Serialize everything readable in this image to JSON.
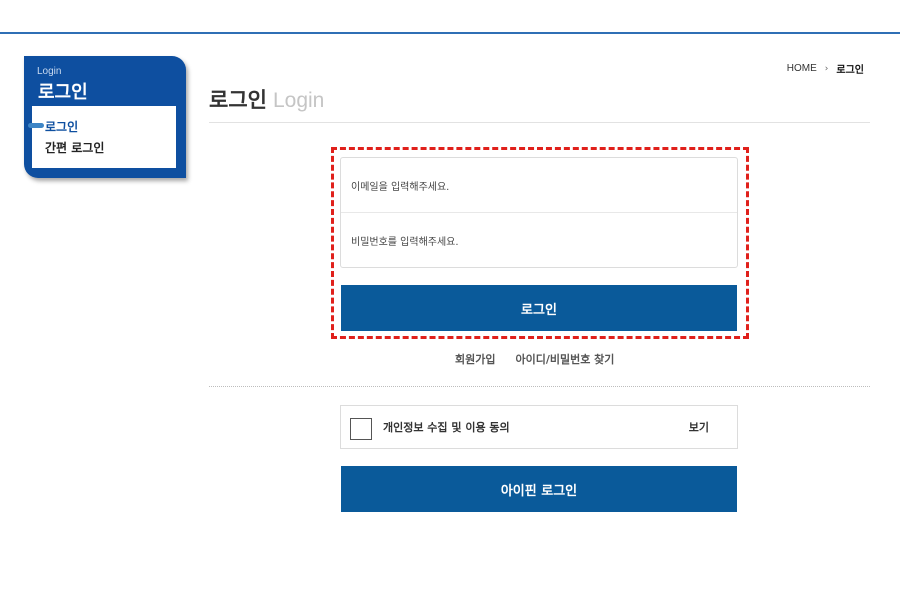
{
  "sidebar": {
    "subtitle": "Login",
    "title": "로그인",
    "items": [
      {
        "label": "로그인",
        "active": true
      },
      {
        "label": "간편 로그인",
        "active": false
      }
    ]
  },
  "breadcrumb": {
    "home": "HOME",
    "separator": "›",
    "current": "로그인"
  },
  "page_title": {
    "korean": "로그인",
    "english": "Login"
  },
  "login_form": {
    "email_placeholder": "이메일을 입력해주세요.",
    "password_placeholder": "비밀번호를 입력해주세요.",
    "login_button": "로그인"
  },
  "links": {
    "signup": "회원가입",
    "find_account": "아이디/비밀번호 찾기"
  },
  "agreement": {
    "label": "개인정보 수집 및 이용 동의",
    "view": "보기",
    "checked": false
  },
  "ipin_button": "아이핀 로그인",
  "colors": {
    "primary": "#0a5a9a",
    "sidebar": "#0e4fa0",
    "highlight": "#e0201b",
    "top_line": "#2f6fb5"
  }
}
